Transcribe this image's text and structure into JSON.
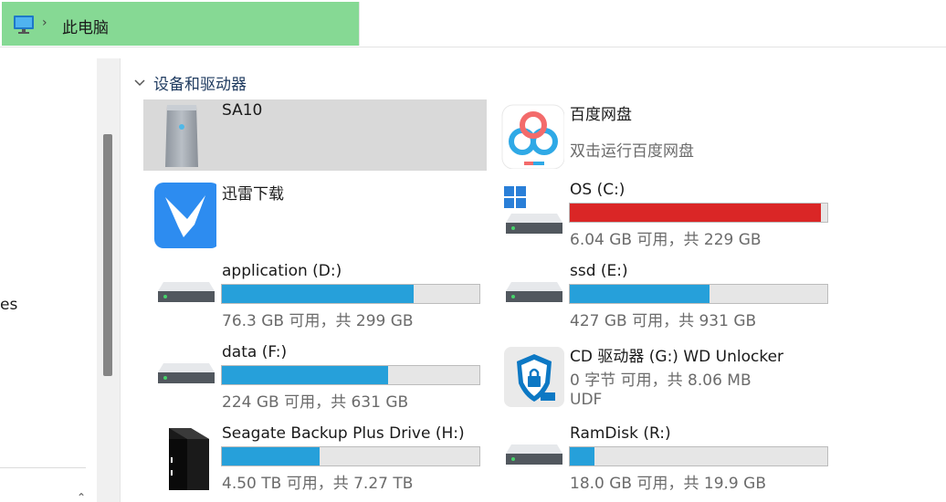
{
  "address": {
    "location": "此电脑",
    "separator": "›"
  },
  "nav": {
    "visible_fragment": "es"
  },
  "group": {
    "title": "设备和驱动器"
  },
  "colors": {
    "normal": "#26a0da",
    "full": "#da2626",
    "highlight": "#86d994",
    "selected": "#d9d9d9"
  },
  "tiles": [
    {
      "name": "SA10",
      "icon": "server-drive-icon"
    },
    {
      "name": "百度网盘",
      "sub": "双击运行百度网盘",
      "icon": "baidu-netdisk-icon"
    },
    {
      "name": "迅雷下载",
      "icon": "xunlei-bird-icon"
    },
    {
      "name": "OS (C:)",
      "free_text": "6.04 GB 可用，共 229 GB",
      "used_fraction": 0.974,
      "bar_state": "full",
      "icon": "windows-drive-icon"
    },
    {
      "name": "application (D:)",
      "free_text": "76.3 GB 可用，共 299 GB",
      "used_fraction": 0.745,
      "bar_state": "normal",
      "icon": "hard-drive-icon"
    },
    {
      "name": "ssd (E:)",
      "free_text": "427 GB 可用，共 931 GB",
      "used_fraction": 0.541,
      "bar_state": "normal",
      "icon": "hard-drive-icon"
    },
    {
      "name": "data (F:)",
      "free_text": "224 GB 可用，共 631 GB",
      "used_fraction": 0.645,
      "bar_state": "normal",
      "icon": "hard-drive-icon"
    },
    {
      "name": "CD 驱动器 (G:) WD Unlocker",
      "sub": "0 字节 可用，共 8.06 MB",
      "sub2": "UDF",
      "icon": "wd-shield-lock-icon"
    },
    {
      "name": "Seagate Backup Plus Drive (H:)",
      "free_text": "4.50 TB 可用，共 7.27 TB",
      "used_fraction": 0.381,
      "bar_state": "normal",
      "icon": "external-drive-icon"
    },
    {
      "name": "RamDisk (R:)",
      "free_text": "18.0 GB 可用，共 19.9 GB",
      "used_fraction": 0.095,
      "bar_state": "normal",
      "icon": "hard-drive-icon"
    }
  ]
}
